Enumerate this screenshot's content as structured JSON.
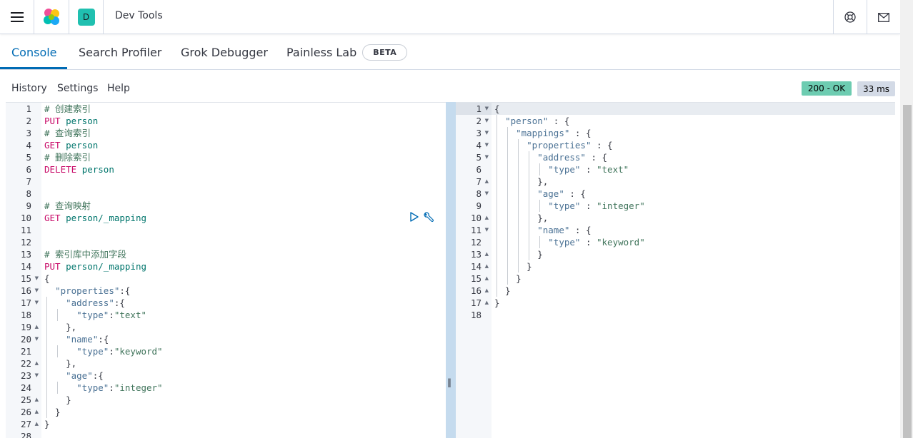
{
  "header": {
    "app_title": "Dev Tools",
    "space_initial": "D",
    "icons": [
      "menu-icon",
      "elastic-logo-icon",
      "help-icon",
      "newsfeed-icon"
    ]
  },
  "tabs": [
    {
      "label": "Console",
      "active": true
    },
    {
      "label": "Search Profiler",
      "active": false
    },
    {
      "label": "Grok Debugger",
      "active": false
    },
    {
      "label": "Painless Lab",
      "active": false,
      "badge": "BETA"
    }
  ],
  "toolbar": {
    "history": "History",
    "settings": "Settings",
    "help": "Help",
    "status": "200 - OK",
    "time": "33 ms"
  },
  "colors": {
    "accent": "#006bb4",
    "status_ok": "#6dccb1",
    "method": "#c80a68",
    "comment": "#41755c",
    "key": "#4a7194"
  },
  "request": {
    "lines": [
      {
        "n": "1",
        "tokens": [
          [
            "c-comment",
            "# 创建索引"
          ]
        ]
      },
      {
        "n": "2",
        "tokens": [
          [
            "c-method",
            "PUT"
          ],
          [
            "c-punc",
            " "
          ],
          [
            "c-url",
            "person"
          ]
        ]
      },
      {
        "n": "3",
        "tokens": [
          [
            "c-comment",
            "# 查询索引"
          ]
        ]
      },
      {
        "n": "4",
        "tokens": [
          [
            "c-method",
            "GET"
          ],
          [
            "c-punc",
            " "
          ],
          [
            "c-url",
            "person"
          ]
        ]
      },
      {
        "n": "5",
        "tokens": [
          [
            "c-comment",
            "# 删除索引"
          ]
        ]
      },
      {
        "n": "6",
        "tokens": [
          [
            "c-method",
            "DELETE"
          ],
          [
            "c-punc",
            " "
          ],
          [
            "c-url",
            "person"
          ]
        ]
      },
      {
        "n": "7",
        "tokens": []
      },
      {
        "n": "8",
        "tokens": []
      },
      {
        "n": "9",
        "tokens": [
          [
            "c-comment",
            "# 查询映射"
          ]
        ]
      },
      {
        "n": "10",
        "tokens": [
          [
            "c-method",
            "GET"
          ],
          [
            "c-punc",
            " "
          ],
          [
            "c-url",
            "person/_mapping"
          ]
        ]
      },
      {
        "n": "11",
        "tokens": []
      },
      {
        "n": "12",
        "tokens": []
      },
      {
        "n": "13",
        "tokens": [
          [
            "c-comment",
            "# 索引库中添加字段"
          ]
        ]
      },
      {
        "n": "14",
        "tokens": [
          [
            "c-method",
            "PUT"
          ],
          [
            "c-punc",
            " "
          ],
          [
            "c-url",
            "person/_mapping"
          ]
        ]
      },
      {
        "n": "15",
        "fold": "open",
        "tokens": [
          [
            "c-punc",
            "{"
          ]
        ]
      },
      {
        "n": "16",
        "fold": "open",
        "tokens": [
          [
            "c-punc",
            "  "
          ],
          [
            "c-key",
            "\"properties\""
          ],
          [
            "c-punc",
            ":{"
          ]
        ]
      },
      {
        "n": "17",
        "fold": "open",
        "tokens": [
          [
            "c-punc",
            "    "
          ],
          [
            "c-key",
            "\"address\""
          ],
          [
            "c-punc",
            ":{"
          ]
        ]
      },
      {
        "n": "18",
        "tokens": [
          [
            "c-punc",
            "      "
          ],
          [
            "c-key",
            "\"type\""
          ],
          [
            "c-punc",
            ":"
          ],
          [
            "c-str",
            "\"text\""
          ]
        ]
      },
      {
        "n": "19",
        "fold": "close",
        "tokens": [
          [
            "c-punc",
            "    },"
          ]
        ]
      },
      {
        "n": "20",
        "fold": "open",
        "tokens": [
          [
            "c-punc",
            "    "
          ],
          [
            "c-key",
            "\"name\""
          ],
          [
            "c-punc",
            ":{"
          ]
        ]
      },
      {
        "n": "21",
        "tokens": [
          [
            "c-punc",
            "      "
          ],
          [
            "c-key",
            "\"type\""
          ],
          [
            "c-punc",
            ":"
          ],
          [
            "c-str",
            "\"keyword\""
          ]
        ]
      },
      {
        "n": "22",
        "fold": "close",
        "tokens": [
          [
            "c-punc",
            "    },"
          ]
        ]
      },
      {
        "n": "23",
        "fold": "open",
        "tokens": [
          [
            "c-punc",
            "    "
          ],
          [
            "c-key",
            "\"age\""
          ],
          [
            "c-punc",
            ":{"
          ]
        ]
      },
      {
        "n": "24",
        "tokens": [
          [
            "c-punc",
            "      "
          ],
          [
            "c-key",
            "\"type\""
          ],
          [
            "c-punc",
            ":"
          ],
          [
            "c-str",
            "\"integer\""
          ]
        ]
      },
      {
        "n": "25",
        "fold": "close",
        "tokens": [
          [
            "c-punc",
            "    }"
          ]
        ]
      },
      {
        "n": "26",
        "fold": "close",
        "tokens": [
          [
            "c-punc",
            "  }"
          ]
        ]
      },
      {
        "n": "27",
        "fold": "close",
        "tokens": [
          [
            "c-punc",
            "}"
          ]
        ]
      },
      {
        "n": "28",
        "tokens": []
      }
    ]
  },
  "response": {
    "lines": [
      {
        "n": "1",
        "fold": "open",
        "tokens": [
          [
            "c-punc",
            "{"
          ]
        ]
      },
      {
        "n": "2",
        "fold": "open",
        "tokens": [
          [
            "c-punc",
            "  "
          ],
          [
            "c-key",
            "\"person\""
          ],
          [
            "c-punc",
            " : {"
          ]
        ]
      },
      {
        "n": "3",
        "fold": "open",
        "tokens": [
          [
            "c-punc",
            "    "
          ],
          [
            "c-key",
            "\"mappings\""
          ],
          [
            "c-punc",
            " : {"
          ]
        ]
      },
      {
        "n": "4",
        "fold": "open",
        "tokens": [
          [
            "c-punc",
            "      "
          ],
          [
            "c-key",
            "\"properties\""
          ],
          [
            "c-punc",
            " : {"
          ]
        ]
      },
      {
        "n": "5",
        "fold": "open",
        "tokens": [
          [
            "c-punc",
            "        "
          ],
          [
            "c-key",
            "\"address\""
          ],
          [
            "c-punc",
            " : {"
          ]
        ]
      },
      {
        "n": "6",
        "tokens": [
          [
            "c-punc",
            "          "
          ],
          [
            "c-key",
            "\"type\""
          ],
          [
            "c-punc",
            " : "
          ],
          [
            "c-str",
            "\"text\""
          ]
        ]
      },
      {
        "n": "7",
        "fold": "close",
        "tokens": [
          [
            "c-punc",
            "        },"
          ]
        ]
      },
      {
        "n": "8",
        "fold": "open",
        "tokens": [
          [
            "c-punc",
            "        "
          ],
          [
            "c-key",
            "\"age\""
          ],
          [
            "c-punc",
            " : {"
          ]
        ]
      },
      {
        "n": "9",
        "tokens": [
          [
            "c-punc",
            "          "
          ],
          [
            "c-key",
            "\"type\""
          ],
          [
            "c-punc",
            " : "
          ],
          [
            "c-str",
            "\"integer\""
          ]
        ]
      },
      {
        "n": "10",
        "fold": "close",
        "tokens": [
          [
            "c-punc",
            "        },"
          ]
        ]
      },
      {
        "n": "11",
        "fold": "open",
        "tokens": [
          [
            "c-punc",
            "        "
          ],
          [
            "c-key",
            "\"name\""
          ],
          [
            "c-punc",
            " : {"
          ]
        ]
      },
      {
        "n": "12",
        "tokens": [
          [
            "c-punc",
            "          "
          ],
          [
            "c-key",
            "\"type\""
          ],
          [
            "c-punc",
            " : "
          ],
          [
            "c-str",
            "\"keyword\""
          ]
        ]
      },
      {
        "n": "13",
        "fold": "close",
        "tokens": [
          [
            "c-punc",
            "        }"
          ]
        ]
      },
      {
        "n": "14",
        "fold": "close",
        "tokens": [
          [
            "c-punc",
            "      }"
          ]
        ]
      },
      {
        "n": "15",
        "fold": "close",
        "tokens": [
          [
            "c-punc",
            "    }"
          ]
        ]
      },
      {
        "n": "16",
        "fold": "close",
        "tokens": [
          [
            "c-punc",
            "  }"
          ]
        ]
      },
      {
        "n": "17",
        "fold": "close",
        "tokens": [
          [
            "c-punc",
            "}"
          ]
        ]
      },
      {
        "n": "18",
        "tokens": []
      }
    ]
  }
}
